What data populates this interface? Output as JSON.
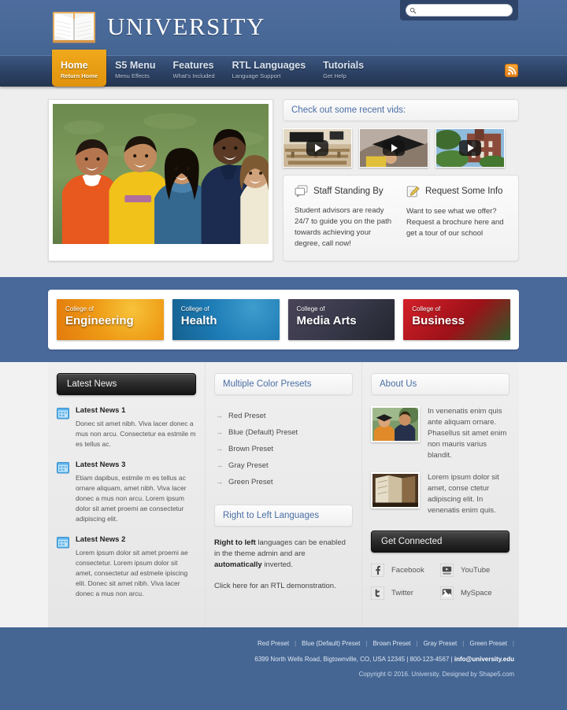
{
  "header": {
    "logo_text": "UNIVERSITY",
    "logo_icon": "open-book-icon",
    "search_placeholder": "",
    "search_value": "",
    "search_icon": "search-icon"
  },
  "nav": {
    "rss_icon": "rss-icon",
    "items": [
      {
        "label": "Home",
        "desc": "Return Home",
        "active": true
      },
      {
        "label": "S5 Menu",
        "desc": "Menu Effects",
        "active": false
      },
      {
        "label": "Features",
        "desc": "What's Included",
        "active": false
      },
      {
        "label": "RTL Languages",
        "desc": "Language Support",
        "active": false
      },
      {
        "label": "Tutorials",
        "desc": "Get Help",
        "active": false
      }
    ]
  },
  "hero": {
    "image_alt": "group-of-five-students-on-grass"
  },
  "videos": {
    "title": "Check out some recent vids:",
    "items": [
      {
        "alt": "classroom-lecture-hall",
        "play_icon": "play-icon"
      },
      {
        "alt": "graduation-cap-student",
        "play_icon": "play-icon"
      },
      {
        "alt": "campus-brick-building",
        "play_icon": "play-icon"
      }
    ]
  },
  "info": [
    {
      "icon": "chat-bubbles-icon",
      "title": "Staff Standing By",
      "text": "Student advisors are ready 24/7 to guide you on the path towards achieving your degree, call now!"
    },
    {
      "icon": "notepad-pencil-icon",
      "title": "Request Some Info",
      "text": "Want to see what we offer? Request a brochure here and get a tour of our school"
    }
  ],
  "colleges": [
    {
      "pre": "College of",
      "name": "Engineering",
      "color": "#ef8b12"
    },
    {
      "pre": "College of",
      "name": "Health",
      "color": "#1d7bb5"
    },
    {
      "pre": "College of",
      "name": "Media Arts",
      "color": "#3a3a4c"
    },
    {
      "pre": "College of",
      "name": "Business",
      "color": "#b8121b"
    }
  ],
  "news": {
    "title": "Latest News",
    "items": [
      {
        "icon": "calendar-icon",
        "title": "Latest News 1",
        "text": "Donec sit amet nibh. Viva lacer donec a mus non arcu. Consectetur ea estmile m es tellus ac."
      },
      {
        "icon": "calendar-icon",
        "title": "Latest News 3",
        "text": "Etiam dapibus, estmile m es tellus ac ornare aliquam, amet nibh. Viva lacer donec a mus non arcu. Lorem ipsum dolor sit amet proemi ae consectetur adipiscing elit."
      },
      {
        "icon": "calendar-icon",
        "title": "Latest News 2",
        "text": "Lorem ipsum dolor sit amet proemi ae consectetur. Lorem ipsum dolor sit amet, consectetur ad estmele ipiscing elit. Donec sit amet nibh. Viva lacer donec a mus non arcu."
      }
    ]
  },
  "presets": {
    "title": "Multiple Color Presets",
    "items": [
      "Red Preset",
      "Blue (Default) Preset",
      "Brown Preset",
      "Gray Preset",
      "Green Preset"
    ]
  },
  "rtl": {
    "title": "Right to Left Languages",
    "bold_lead": "Right to left",
    "body_part1": " languages can be enabled in the theme admin and are ",
    "bold_mid": "automatically",
    "body_part2": " inverted.",
    "link": "Click here for an RTL demonstration."
  },
  "about": {
    "title": "About Us",
    "items": [
      {
        "image_alt": "two-graduates-smiling",
        "text": "In venenatis enim quis ante aliquam ornare. Phasellus sit amet enim non mauris varius blandit."
      },
      {
        "image_alt": "library-books-shelf",
        "text": "Lorem ipsum dolor sit amet, conse ctetur adipiscing elit. In venenatis enim quis."
      }
    ]
  },
  "connect": {
    "title": "Get Connected",
    "items": [
      {
        "icon": "facebook-icon",
        "label": "Facebook"
      },
      {
        "icon": "youtube-icon",
        "label": "YouTube"
      },
      {
        "icon": "twitter-icon",
        "label": "Twitter"
      },
      {
        "icon": "myspace-icon",
        "label": "MySpace"
      }
    ]
  },
  "footer": {
    "presets": [
      "Red Preset",
      "Blue (Default) Preset",
      "Brown Preset",
      "Gray Preset",
      "Green Preset"
    ],
    "address": "6399 North Wells Road, Bigtownville, CO, USA 12345 | 800-123-4567 | ",
    "email": "info@university.edu",
    "copyright": "Copyright © 2016. University. Designed by Shape5.com"
  }
}
